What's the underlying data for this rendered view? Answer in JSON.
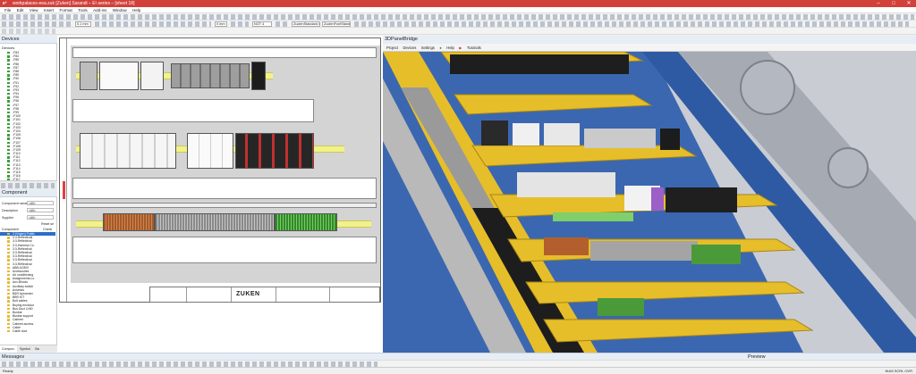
{
  "window": {
    "title": "workpalaces-eea.zuk [Zuken] Sarandi – E³.series – [sheet 18]",
    "min": "–",
    "max": "□",
    "close": "✕"
  },
  "menu": [
    "File",
    "Edit",
    "View",
    "Insert",
    "Format",
    "Tools",
    "Add-ins",
    "Window",
    "Help"
  ],
  "toolbar": {
    "line_width": "0.1 mm",
    "grid": "0 mm",
    "layer": "NOT 4",
    "font": "ZuolenStandard Comp",
    "style": "ZuolenFontStandard"
  },
  "devices_panel": {
    "title": "Devices",
    "subtitle": "Devices",
    "items": [
      "-F83",
      "-F84",
      "-F85",
      "-F86",
      "-F87",
      "-F88",
      "-F89",
      "-F90",
      "-F91",
      "-F92",
      "-F93",
      "-F94",
      "-F95",
      "-F96",
      "-F97",
      "-F98",
      "-F99",
      "-F100",
      "-F101",
      "-F102",
      "-F103",
      "-F104",
      "-F105",
      "-F106",
      "-F107",
      "-F108",
      "-F109",
      "-F110",
      "-F111",
      "-F112",
      "-F113",
      "-F114",
      "-F115",
      "-F116",
      "-F117",
      "-F118",
      "-X1"
    ],
    "selected": "-X1 (SP)"
  },
  "component_panel": {
    "title": "Component",
    "fields": [
      {
        "label": "Component name",
        "value": "<All>"
      },
      {
        "label": "Description",
        "value": "<All>"
      },
      {
        "label": "Supplier",
        "value": "<All>"
      }
    ],
    "reset": "Reset se",
    "col_component": "Component",
    "col_check": "Check",
    "items": [
      "2:(Vsgen) Public",
      "3:3-Reflectivial",
      "3:3-Reflectival",
      "3:3-Harness Co.",
      "3:3-Reflectival",
      "3:3-Reflectival",
      "3:3-Reflectival",
      "3:3-Reflectival",
      "3:3-Reflectival",
      "ABB AC800",
      "Accessories",
      "Air conditioning",
      "Assignments-Lo",
      "Aux-Blocks",
      "Auxiliary switch",
      "Axiomos",
      "B&R Aprosmex",
      "BBR KIT",
      "Bolt cables",
      "Buying enclosur",
      "Bus-Duct LV60",
      "Busbar",
      "Busbar support",
      "Cabinet",
      "Cabinet access.",
      "Cable",
      "Cable duct"
    ],
    "tabs": [
      "Compon.",
      "Symbol",
      "Ba"
    ]
  },
  "view3d": {
    "title": "3DPanelBridge",
    "menu": [
      "Project",
      "Devices",
      "Settings",
      "Help",
      "Tutorials"
    ]
  },
  "drawing": {
    "logo": "ZUKEN"
  },
  "messages": {
    "title": "Messages"
  },
  "preview": {
    "title": "Preview"
  },
  "status": {
    "left": "Ready",
    "right": "NUM  SCRL  OVR"
  },
  "colors": {
    "titlebar": "#d2403a",
    "rail": "#f2f28a",
    "scene_blue": "#3b67b0",
    "scene_yellow": "#e6be2a"
  }
}
